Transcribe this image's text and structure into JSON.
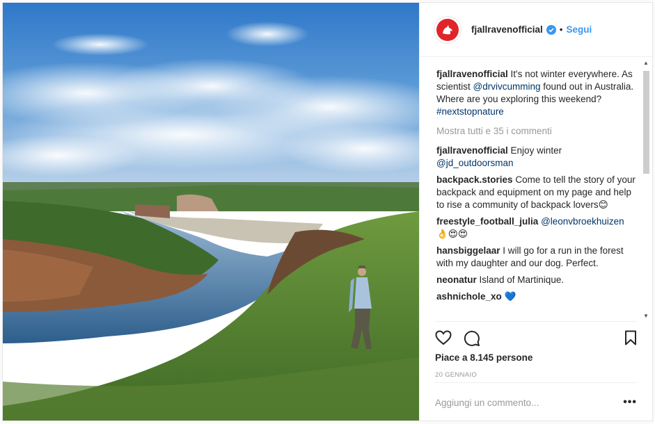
{
  "post": {
    "username": "fjallravenofficial",
    "separator": "•",
    "follow_label": "Segui",
    "caption": {
      "user": "fjallravenofficial",
      "text_1": " It's not winter everywhere. As scientist ",
      "mention": "@drvivcumming",
      "text_2": " found out in Australia. Where are you exploring this weekend? ",
      "hashtag": "#nextstopnature"
    },
    "view_all_label": "Mostra tutti e 35 i commenti",
    "comments": [
      {
        "user": "fjallravenofficial",
        "text": " Enjoy winter ",
        "mention": "@jd_outdoorsman"
      },
      {
        "user": "backpack.stories",
        "text": " Come to tell the story of your backpack and equipment on my page and help to rise a community of backpack lovers😊",
        "mention": ""
      },
      {
        "user": "freestyle_football_julia",
        "text": " ",
        "mention": "@leonvbroekhuizen",
        "after": " 👌😍😍"
      },
      {
        "user": "hansbiggelaar",
        "text": " I will go for a run in the forest with my daughter and our dog. Perfect.",
        "mention": ""
      },
      {
        "user": "neonatur",
        "text": " Island of Martinique.",
        "mention": ""
      },
      {
        "user": "ashnichole_xo",
        "text": " 💙",
        "mention": ""
      }
    ],
    "likes_label": "Piace a 8.145 persone",
    "date_label": "20 GENNAIO",
    "add_comment_placeholder": "Aggiungi un commento...",
    "options_label": "•••"
  },
  "icons": {
    "heart": "heart-icon",
    "comment": "comment-icon",
    "bookmark": "bookmark-icon",
    "verified": "verified-badge-icon",
    "avatar_logo": "fox-logo-icon"
  },
  "colors": {
    "link": "#003569",
    "follow": "#3897f0",
    "brand_red": "#e0242a",
    "muted": "#999999"
  }
}
